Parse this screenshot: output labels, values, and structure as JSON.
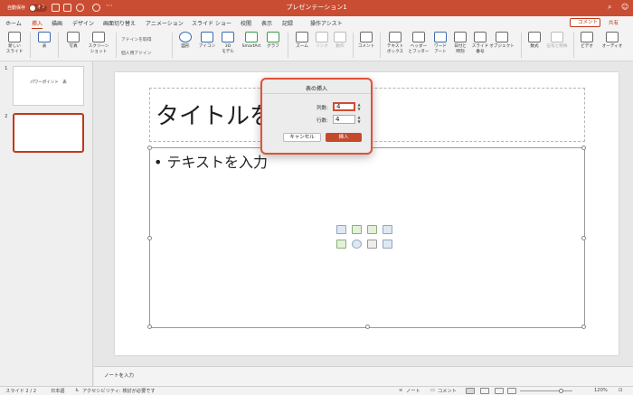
{
  "window": {
    "title": "プレゼンテーション1",
    "autosave_label": "自動保存",
    "autosave_state": "オフ"
  },
  "tabs": [
    "ホーム",
    "挿入",
    "描画",
    "デザイン",
    "画面切り替え",
    "アニメーション",
    "スライド ショー",
    "校閲",
    "表示",
    "記録",
    "操作アシスト"
  ],
  "active_tab": "挿入",
  "header_buttons": {
    "comment": "コメント",
    "share": "共有"
  },
  "ribbon": {
    "new_slide": "新しい\nスライド",
    "table": "表",
    "photo": "写真",
    "screenshot": "スクリーン\nショット",
    "get_addins": "アドインを取得",
    "my_addins": "個人用アドイン",
    "shapes": "図形",
    "icons": "アイコン",
    "models_3d": "3D\nモデル",
    "smartart": "SmartArt",
    "chart": "グラフ",
    "zoom": "ズーム",
    "link": "リンク",
    "action": "動作",
    "comment": "コメント",
    "textbox": "テキスト\nボックス",
    "header_footer": "ヘッダー\nとフッター",
    "wordart": "ワード\nアート",
    "date_time": "日付と\n時刻",
    "slide_number": "スライド\n番号",
    "object": "オブジェクト",
    "equation": "数式",
    "symbol": "記号と特殊",
    "video": "ビデオ",
    "audio": "オーディオ"
  },
  "slides_panel": {
    "thumbs": [
      {
        "num": "1",
        "text": "パワーポイント　表"
      },
      {
        "num": "2",
        "text": ""
      }
    ]
  },
  "slide": {
    "title_placeholder": "タイトルを",
    "content_placeholder": "• テキストを入力"
  },
  "notes_placeholder": "ノートを入力",
  "status": {
    "slide_info": "スライド 2 / 2",
    "language": "日本語",
    "accessibility": "アクセシビリティ: 検討が必要です",
    "notes": "ノート",
    "comments": "コメント",
    "zoom": "120%"
  },
  "dialog": {
    "title": "表の挿入",
    "columns_label": "列数:",
    "columns_value": "4",
    "rows_label": "行数:",
    "rows_value": "4",
    "cancel": "キャンセル",
    "insert": "挿入"
  },
  "colors": {
    "accent": "#c0391b",
    "titlebar": "#c94d32",
    "insert_button": "#c44a2b"
  }
}
